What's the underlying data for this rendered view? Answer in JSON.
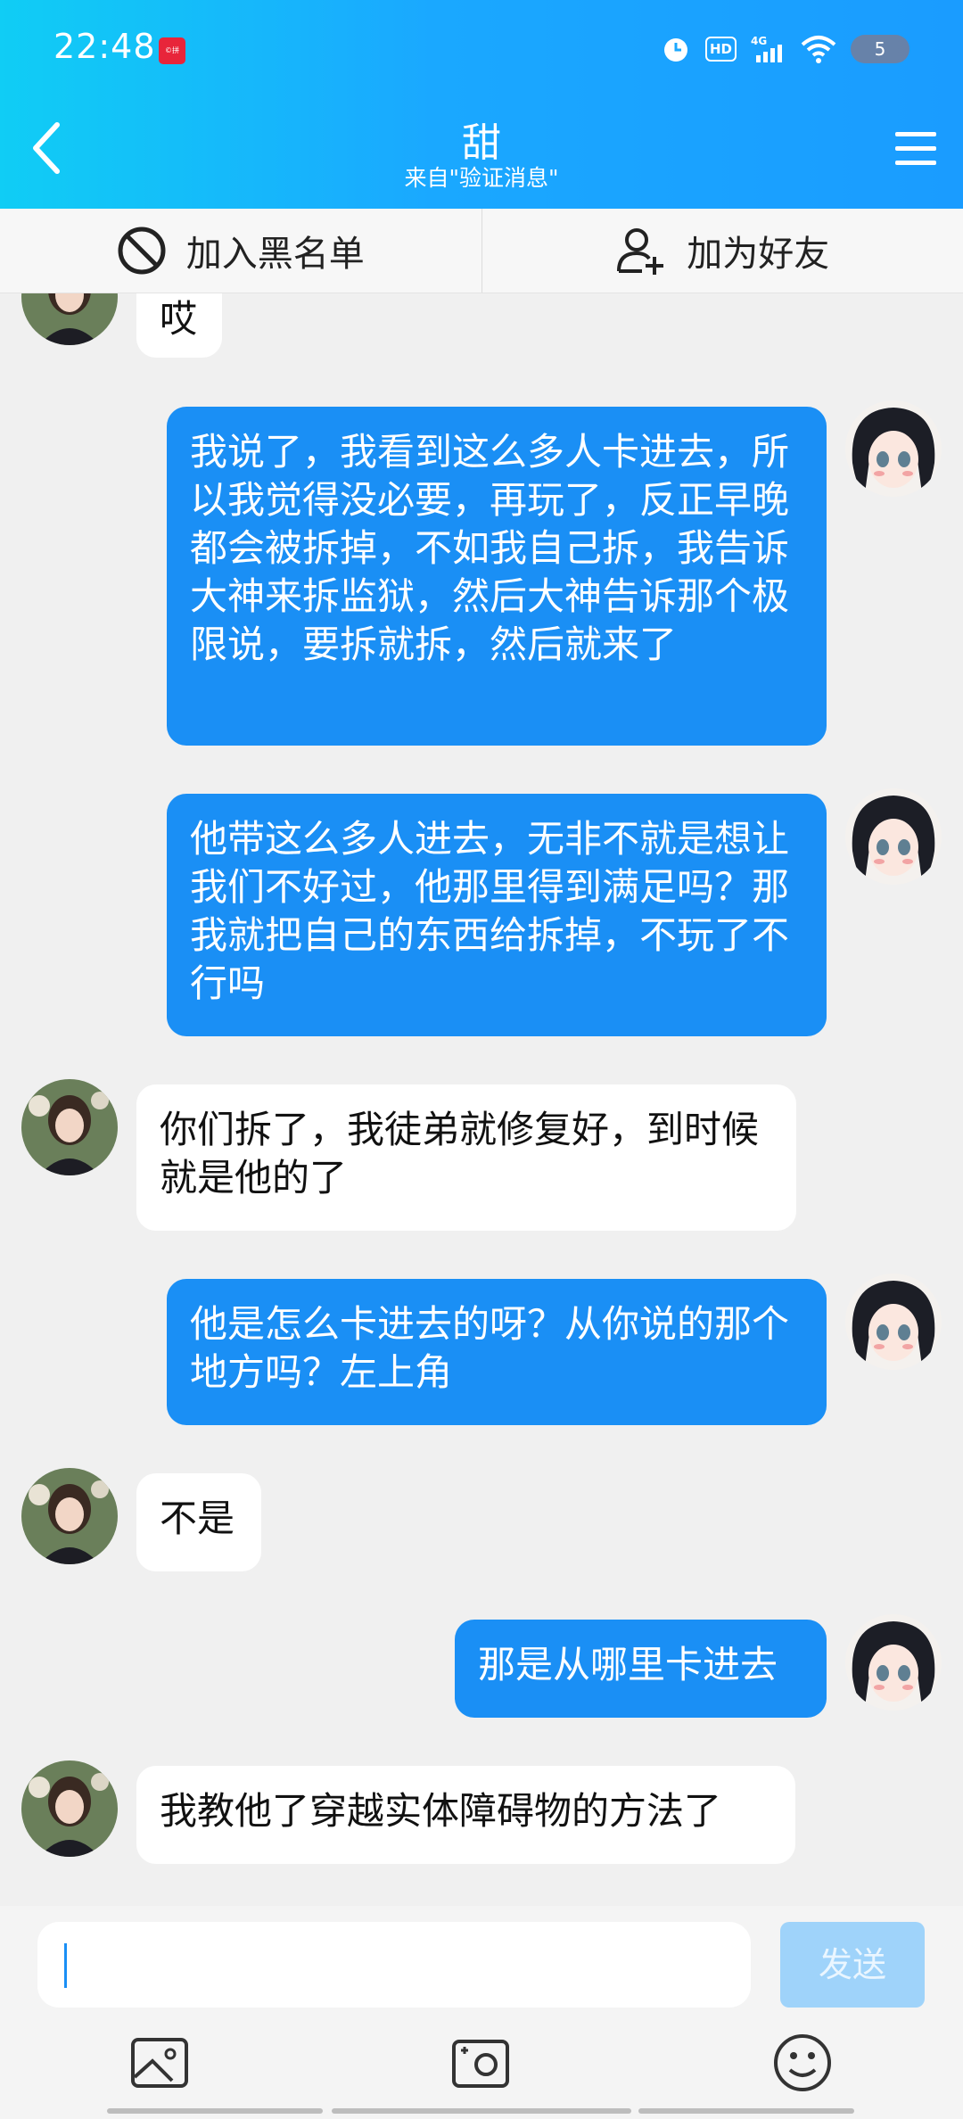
{
  "status_bar": {
    "time": "22:48",
    "app_icon_text": "©拼",
    "hd_label": "HD",
    "network": "4G",
    "battery": "5"
  },
  "header": {
    "title": "甜",
    "subtitle": "来自\"验证消息\""
  },
  "actions": {
    "blacklist": "加入黑名单",
    "add_friend": "加为好友"
  },
  "messages": [
    {
      "side": "in",
      "text": "哎"
    },
    {
      "side": "out",
      "text": "我说了，我看到这么多人卡进去，所以我觉得没必要，再玩了，反正早晚都会被拆掉，不如我自己拆，我告诉大神来拆监狱，然后大神告诉那个极限说，要拆就拆，然后就来了"
    },
    {
      "side": "out",
      "text": "他带这么多人进去，无非不就是想让我们不好过，他那里得到满足吗？那我就把自己的东西给拆掉，不玩了不行吗"
    },
    {
      "side": "in",
      "text": "你们拆了，我徒弟就修复好，到时候就是他的了"
    },
    {
      "side": "out",
      "text": "他是怎么卡进去的呀？从你说的那个地方吗？左上角"
    },
    {
      "side": "in",
      "text": "不是"
    },
    {
      "side": "out",
      "text": "那是从哪里卡进去"
    },
    {
      "side": "in",
      "text": "我教他了穿越实体障碍物的方法了"
    }
  ],
  "input": {
    "value": "",
    "send_label": "发送"
  },
  "colors": {
    "header_gradient_start": "#10cdf5",
    "header_gradient_end": "#1a9cff",
    "outgoing_bubble": "#1a8ff5",
    "incoming_bubble": "#ffffff",
    "send_button_disabled": "#9fd3fa"
  }
}
